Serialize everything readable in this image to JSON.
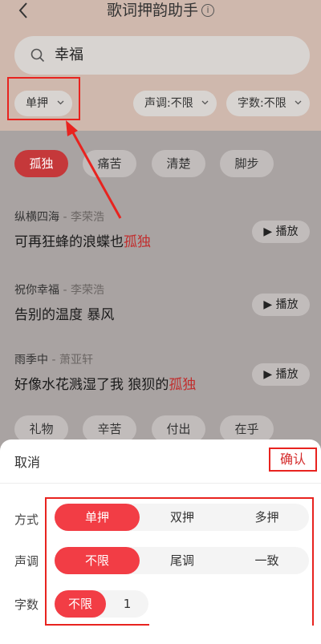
{
  "header": {
    "title": "歌词押韵助手",
    "info_icon": "i"
  },
  "search": {
    "value": "幸福"
  },
  "filters": {
    "rhyme": "单押",
    "tone": "声调:不限",
    "count": "字数:不限"
  },
  "tags_top": [
    "孤独",
    "痛苦",
    "清楚",
    "脚步"
  ],
  "songs": [
    {
      "title": "纵横四海",
      "artist": "李荣浩",
      "lyric_pre": "可再狂蜂的浪蝶也",
      "lyric_hl": "孤独",
      "play": "播放"
    },
    {
      "title": "祝你幸福",
      "artist": "李荣浩",
      "lyric_pre": "告别的温度 暴风",
      "lyric_hl": "",
      "play": "播放"
    },
    {
      "title": "雨季中",
      "artist": "萧亚轩",
      "lyric_pre": "好像水花溅湿了我 狼狈的",
      "lyric_hl": "孤独",
      "play": "播放"
    }
  ],
  "tags_bottom": [
    "礼物",
    "辛苦",
    "付出",
    "在乎"
  ],
  "sheet": {
    "cancel": "取消",
    "confirm": "确认",
    "method_label": "方式",
    "method_options": [
      "单押",
      "双押",
      "多押"
    ],
    "tone_label": "声调",
    "tone_options": [
      "不限",
      "尾调",
      "一致"
    ],
    "count_label": "字数",
    "count_options": [
      "不限",
      "1"
    ]
  },
  "colors": {
    "accent": "#f23d45",
    "annotation": "#e8231f"
  }
}
